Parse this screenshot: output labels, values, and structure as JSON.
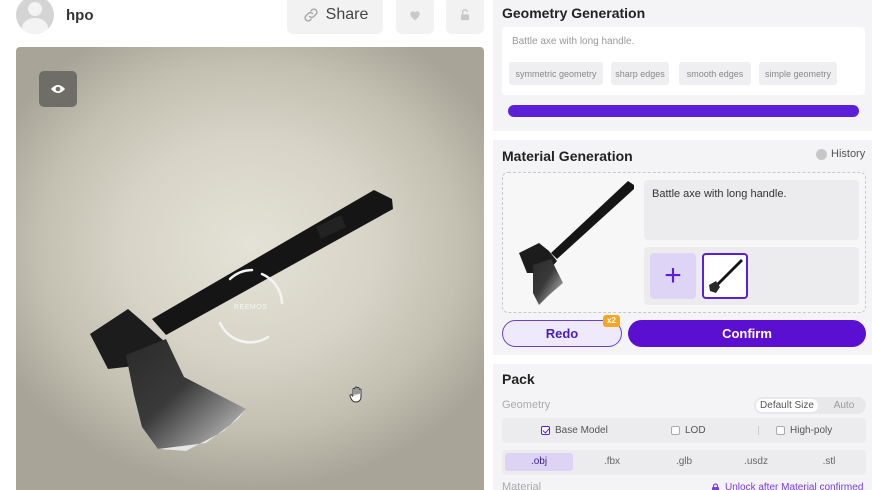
{
  "user": {
    "name": "hpo"
  },
  "toolbar": {
    "share_label": "Share"
  },
  "viewport": {
    "watermark": "REEMOS"
  },
  "geometry": {
    "title": "Geometry Generation",
    "prompt": "Battle axe with long handle.",
    "tags": [
      "symmetric geometry",
      "sharp edges",
      "smooth edges",
      "simple geometry"
    ],
    "progress": 1.0,
    "progress_color": "#5b1fd9"
  },
  "material": {
    "title": "Material Generation",
    "history_label": "History",
    "prompt": "Battle axe with long handle.",
    "add_label": "+",
    "redo_label": "Redo",
    "redo_badge": "x2",
    "confirm_label": "Confirm",
    "accent": "#5b0fd0"
  },
  "pack": {
    "title": "Pack",
    "geometry_label": "Geometry",
    "size_options": [
      "Default Size",
      "Auto"
    ],
    "model_options": [
      {
        "label": "Base Model",
        "checked": true
      },
      {
        "label": "LOD",
        "checked": false
      },
      {
        "label": "High-poly",
        "checked": false
      }
    ],
    "formats": [
      ".obj",
      ".fbx",
      ".glb",
      ".usdz",
      ".stl"
    ],
    "selected_format": ".obj",
    "material_label": "Material",
    "unlock_text": "Unlock after Material confirmed"
  }
}
